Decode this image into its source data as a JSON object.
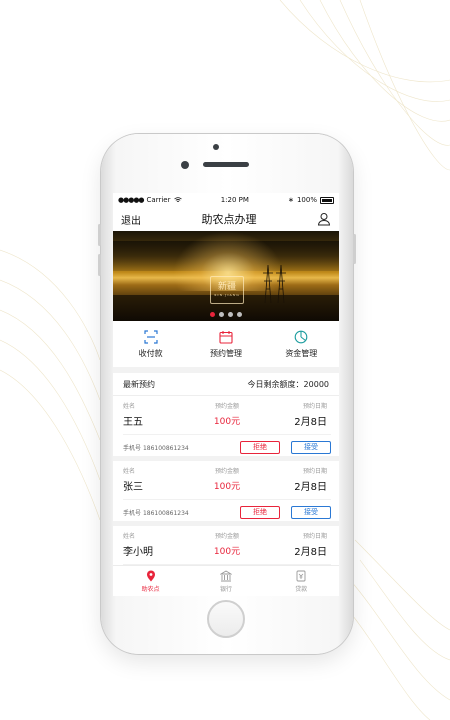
{
  "status_bar": {
    "carrier": "Carrier",
    "time": "1:20 PM",
    "battery": "100%"
  },
  "navbar": {
    "back": "退出",
    "title": "助农点办理"
  },
  "banner": {
    "logo_text": "新疆",
    "logo_sub": "XIN·JIANG",
    "active_index": 0,
    "dot_count": 4
  },
  "quick_actions": [
    {
      "label": "收付款",
      "icon": "scan-icon"
    },
    {
      "label": "预约管理",
      "icon": "calendar-icon"
    },
    {
      "label": "资金管理",
      "icon": "pie-chart-icon"
    }
  ],
  "summary": {
    "title": "最新预约",
    "quota_label": "今日剩余额度：",
    "quota_value": "20000"
  },
  "reservation_headers": {
    "name": "姓名",
    "amount": "预约金额",
    "date": "预约日期",
    "phone_prefix": "手机号"
  },
  "reservations": [
    {
      "name": "王五",
      "amount": "100元",
      "date": "2月8日",
      "phone": "18610086​1234"
    },
    {
      "name": "张三",
      "amount": "100元",
      "date": "2月8日",
      "phone": "186100861234"
    },
    {
      "name": "李小明",
      "amount": "100元",
      "date": "2月8日",
      "phone": ""
    }
  ],
  "buttons": {
    "reject": "拒绝",
    "accept": "接受"
  },
  "tabbar": [
    {
      "label": "助农点",
      "icon": "location-pin-icon",
      "active": true
    },
    {
      "label": "银行",
      "icon": "bank-icon",
      "active": false
    },
    {
      "label": "贷款",
      "icon": "loan-icon",
      "active": false
    }
  ],
  "colors": {
    "accent_red": "#e8243b",
    "accent_blue": "#2a78d4",
    "quick_icon_teal": "#1f9ea0"
  }
}
